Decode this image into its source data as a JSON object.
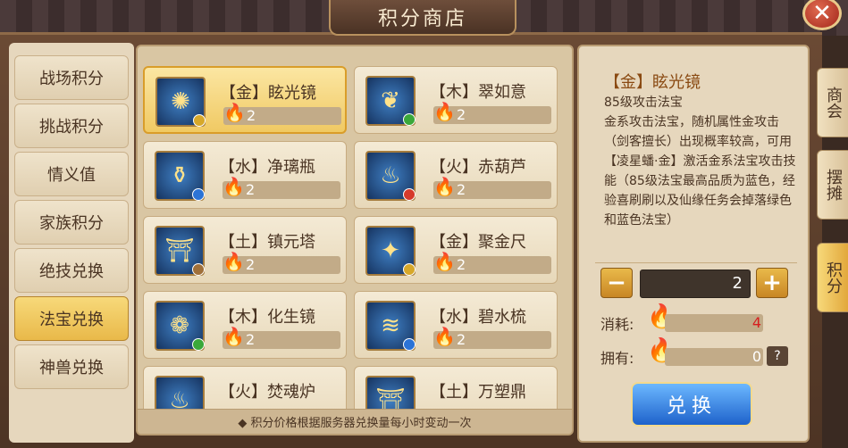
{
  "title": "积分商店",
  "close_label": "✕",
  "nav": [
    {
      "label": "战场积分",
      "active": false
    },
    {
      "label": "挑战积分",
      "active": false
    },
    {
      "label": "情义值",
      "active": false
    },
    {
      "label": "家族积分",
      "active": false
    },
    {
      "label": "绝技兑换",
      "active": false
    },
    {
      "label": "法宝兑换",
      "active": true
    },
    {
      "label": "神兽兑换",
      "active": false
    }
  ],
  "items": [
    {
      "name": "【金】眩光镜",
      "price": "2",
      "icon": "mirror-icon",
      "element_color": "#d7a82a",
      "selected": true
    },
    {
      "name": "【木】翠如意",
      "price": "2",
      "icon": "jade-ruyi-icon",
      "element_color": "#3aa83a",
      "selected": false
    },
    {
      "name": "【水】净璃瓶",
      "price": "2",
      "icon": "vase-icon",
      "element_color": "#2b73d6",
      "selected": false
    },
    {
      "name": "【火】赤葫芦",
      "price": "2",
      "icon": "gourd-icon",
      "element_color": "#d63a2b",
      "selected": false
    },
    {
      "name": "【土】镇元塔",
      "price": "2",
      "icon": "pagoda-icon",
      "element_color": "#a0703a",
      "selected": false
    },
    {
      "name": "【金】聚金尺",
      "price": "2",
      "icon": "ruler-icon",
      "element_color": "#d7a82a",
      "selected": false
    },
    {
      "name": "【木】化生镜",
      "price": "2",
      "icon": "lotus-mirror-icon",
      "element_color": "#3aa83a",
      "selected": false
    },
    {
      "name": "【水】碧水梳",
      "price": "2",
      "icon": "comb-icon",
      "element_color": "#2b73d6",
      "selected": false
    },
    {
      "name": "【火】焚魂炉",
      "price": "",
      "icon": "furnace-icon",
      "element_color": "#d63a2b",
      "selected": false
    },
    {
      "name": "【土】万塑鼎",
      "price": "",
      "icon": "cauldron-icon",
      "element_color": "#a0703a",
      "selected": false
    }
  ],
  "notice": "◆ 积分价格根据服务器兑换量每小时变动一次",
  "detail": {
    "title": "【金】眩光镜",
    "subtitle": "85级攻击法宝",
    "description": "金系攻击法宝，随机属性金攻击（剑客擅长）出现概率较高，可用【凌星蟠·金】激活金系法宝攻击技能（85级法宝最高品质为蓝色，经验喜刷刷以及仙缘任务会掉落绿色和蓝色法宝）",
    "quantity": "2",
    "minus_label": "−",
    "plus_label": "+",
    "cost_label": "消耗:",
    "cost_value": "4",
    "own_label": "拥有:",
    "own_value": "0",
    "help_label": "?",
    "exchange_label": "兑换"
  },
  "side_tabs": [
    {
      "label": "商会",
      "active": false
    },
    {
      "label": "摆摊",
      "active": false
    },
    {
      "label": "积分",
      "active": true
    }
  ],
  "colors": {
    "accent": "#f0a019",
    "cost_red": "#d61f1f",
    "selected_gold": "#f0c963"
  }
}
